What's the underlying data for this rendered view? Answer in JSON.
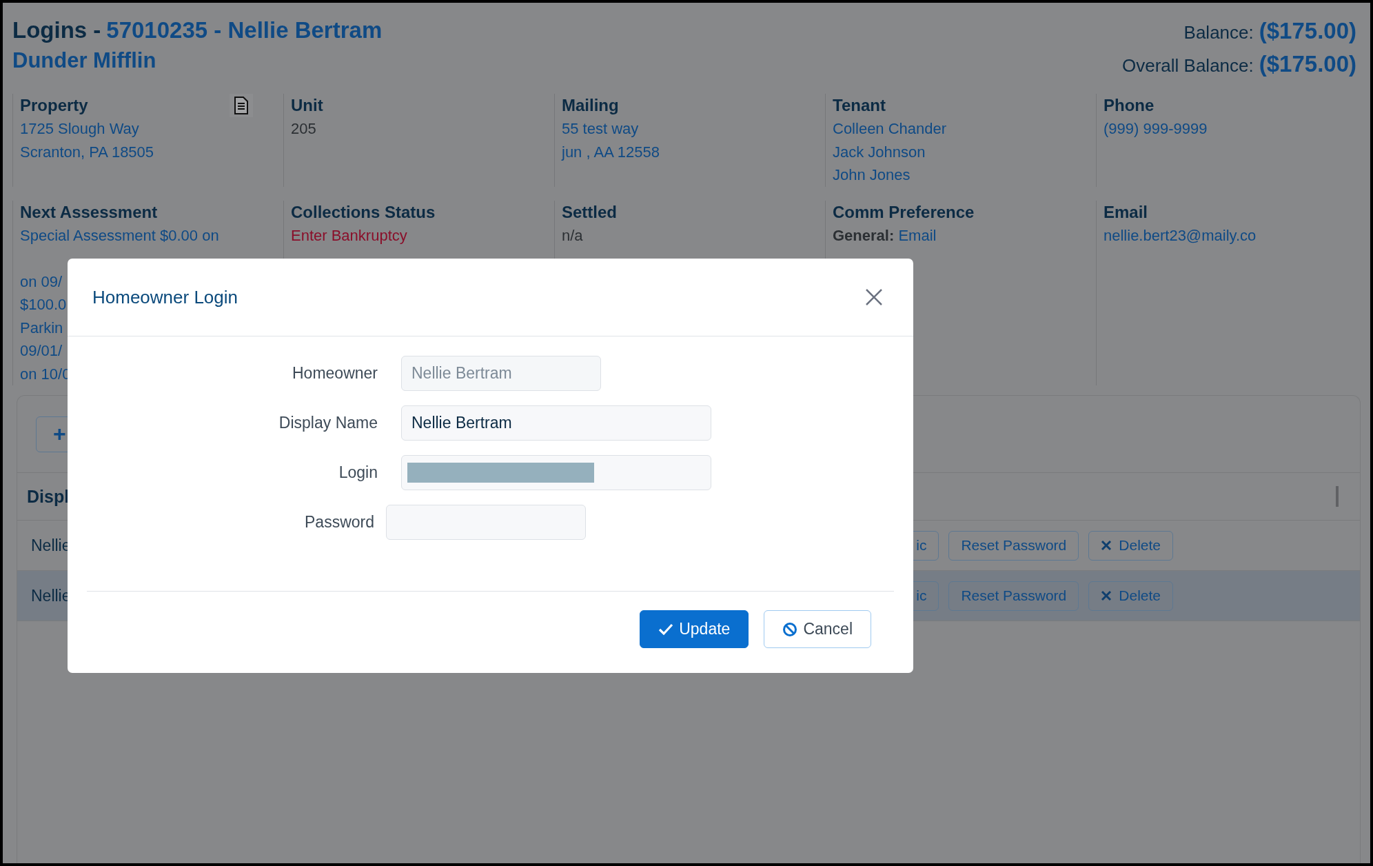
{
  "header": {
    "title_prefix": "Logins -",
    "title_account": "57010235 - Nellie Bertram",
    "subtitle": "Dunder Mifflin",
    "balances": [
      {
        "label": "Balance:",
        "amount": "($175.00)"
      },
      {
        "label": "Overall Balance:",
        "amount": "($175.00)"
      }
    ]
  },
  "details": [
    {
      "label": "Property",
      "kind": "link",
      "lines": [
        "1725 Slough Way",
        "Scranton, PA 18505"
      ],
      "has_document": true
    },
    {
      "label": "Unit",
      "kind": "plain",
      "lines": [
        "205"
      ]
    },
    {
      "label": "Mailing",
      "kind": "link",
      "lines": [
        "55 test way",
        "jun , AA 12558"
      ]
    },
    {
      "label": "Tenant",
      "kind": "link",
      "lines": [
        "Colleen Chander",
        "Jack Johnson",
        "John Jones"
      ]
    },
    {
      "label": "Phone",
      "kind": "link",
      "lines": [
        "(999) 999-9999"
      ]
    },
    {
      "label": "Next Assessment",
      "kind": "link",
      "lines": [
        "Special Assessment $0.00 on"
      ],
      "lines_after_gap": [
        "on 09/",
        "$100.0",
        "Parkin",
        "09/01/",
        "on 10/0"
      ]
    },
    {
      "label": "Collections Status",
      "kind": "alert",
      "lines": [
        "Enter Bankruptcy"
      ]
    },
    {
      "label": "Settled",
      "kind": "plain",
      "lines": [
        "n/a"
      ]
    },
    {
      "label": "Comm Preference",
      "kind": "pairs",
      "pairs": [
        {
          "label": "General:",
          "value": "Email"
        }
      ]
    },
    {
      "label": "Email",
      "kind": "link",
      "lines": [
        "nellie.bert23@maily.co"
      ]
    }
  ],
  "table": {
    "add_button": "+",
    "column_1": "Displ",
    "rows": [
      {
        "cell": "Nellie",
        "selected": false,
        "actions": [
          {
            "kind": "plain",
            "label": "ic"
          },
          {
            "kind": "plain",
            "label": "Reset Password"
          },
          {
            "kind": "delete",
            "label": "Delete"
          }
        ]
      },
      {
        "cell": "Nellie",
        "selected": true,
        "actions": [
          {
            "kind": "plain",
            "label": "ic"
          },
          {
            "kind": "plain",
            "label": "Reset Password"
          },
          {
            "kind": "delete",
            "label": "Delete"
          }
        ]
      }
    ]
  },
  "dialog": {
    "title": "Homeowner Login",
    "fields": [
      {
        "label": "Homeowner",
        "kind": "readonly",
        "value": "Nellie Bertram"
      },
      {
        "label": "Display Name",
        "kind": "text",
        "value": "Nellie Bertram"
      },
      {
        "label": "Login",
        "kind": "redacted"
      },
      {
        "label": "Password",
        "kind": "password"
      }
    ],
    "buttons": [
      {
        "kind": "primary",
        "label": "Update"
      },
      {
        "kind": "cancel",
        "label": "Cancel"
      }
    ]
  }
}
